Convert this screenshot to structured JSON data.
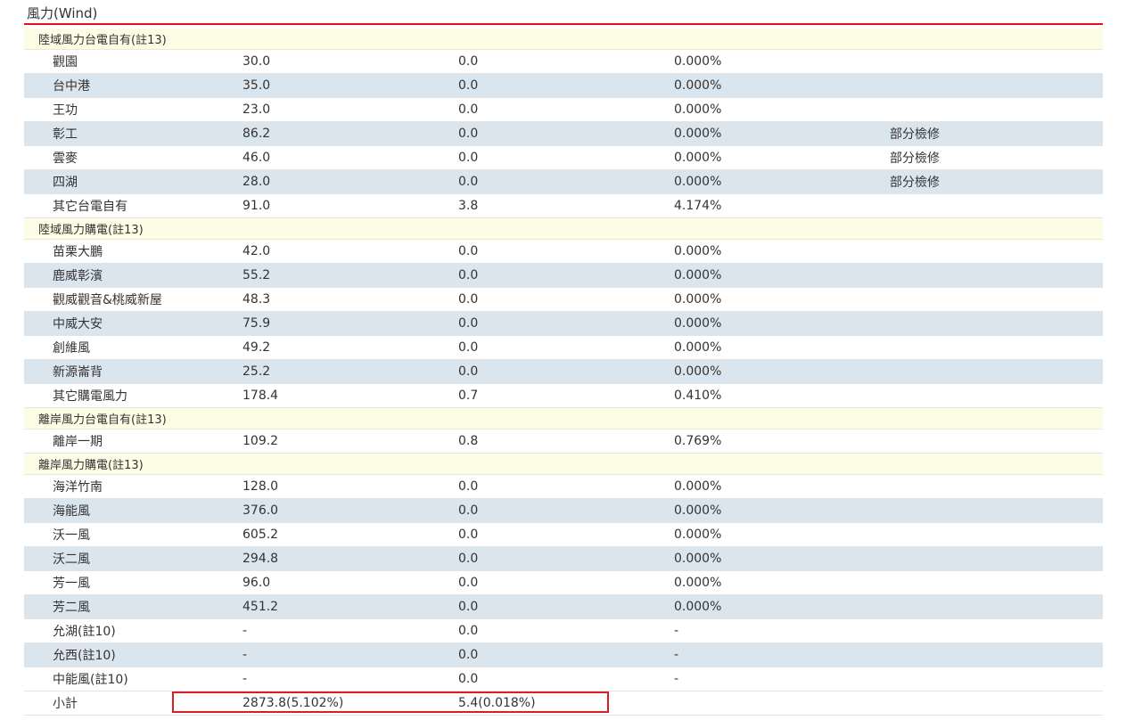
{
  "section": {
    "title": "風力(Wind)"
  },
  "colors": {
    "accent_red": "#e5101a",
    "row_alt": "#dbe5ee",
    "group_bg": "#fdfce4"
  },
  "groups": [
    {
      "label": "陸域風力台電自有(註13)",
      "rows": [
        {
          "name": "觀園",
          "capacity": "30.0",
          "generation": "0.0",
          "ratio": "0.000%",
          "note": ""
        },
        {
          "name": "台中港",
          "capacity": "35.0",
          "generation": "0.0",
          "ratio": "0.000%",
          "note": ""
        },
        {
          "name": "王功",
          "capacity": "23.0",
          "generation": "0.0",
          "ratio": "0.000%",
          "note": ""
        },
        {
          "name": "彰工",
          "capacity": "86.2",
          "generation": "0.0",
          "ratio": "0.000%",
          "note": "部分檢修"
        },
        {
          "name": "雲麥",
          "capacity": "46.0",
          "generation": "0.0",
          "ratio": "0.000%",
          "note": "部分檢修"
        },
        {
          "name": "四湖",
          "capacity": "28.0",
          "generation": "0.0",
          "ratio": "0.000%",
          "note": "部分檢修"
        },
        {
          "name": "其它台電自有",
          "capacity": "91.0",
          "generation": "3.8",
          "ratio": "4.174%",
          "note": ""
        }
      ]
    },
    {
      "label": "陸域風力購電(註13)",
      "rows": [
        {
          "name": "苗栗大鵬",
          "capacity": "42.0",
          "generation": "0.0",
          "ratio": "0.000%",
          "note": ""
        },
        {
          "name": "鹿威彰濱",
          "capacity": "55.2",
          "generation": "0.0",
          "ratio": "0.000%",
          "note": ""
        },
        {
          "name": "觀威觀音&桃威新屋",
          "capacity": "48.3",
          "generation": "0.0",
          "ratio": "0.000%",
          "note": ""
        },
        {
          "name": "中威大安",
          "capacity": "75.9",
          "generation": "0.0",
          "ratio": "0.000%",
          "note": ""
        },
        {
          "name": "創維風",
          "capacity": "49.2",
          "generation": "0.0",
          "ratio": "0.000%",
          "note": ""
        },
        {
          "name": "新源崙背",
          "capacity": "25.2",
          "generation": "0.0",
          "ratio": "0.000%",
          "note": ""
        },
        {
          "name": "其它購電風力",
          "capacity": "178.4",
          "generation": "0.7",
          "ratio": "0.410%",
          "note": ""
        }
      ]
    },
    {
      "label": "離岸風力台電自有(註13)",
      "rows": [
        {
          "name": "離岸一期",
          "capacity": "109.2",
          "generation": "0.8",
          "ratio": "0.769%",
          "note": ""
        }
      ]
    },
    {
      "label": "離岸風力購電(註13)",
      "rows": [
        {
          "name": "海洋竹南",
          "capacity": "128.0",
          "generation": "0.0",
          "ratio": "0.000%",
          "note": ""
        },
        {
          "name": "海能風",
          "capacity": "376.0",
          "generation": "0.0",
          "ratio": "0.000%",
          "note": ""
        },
        {
          "name": "沃一風",
          "capacity": "605.2",
          "generation": "0.0",
          "ratio": "0.000%",
          "note": ""
        },
        {
          "name": "沃二風",
          "capacity": "294.8",
          "generation": "0.0",
          "ratio": "0.000%",
          "note": ""
        },
        {
          "name": "芳一風",
          "capacity": "96.0",
          "generation": "0.0",
          "ratio": "0.000%",
          "note": ""
        },
        {
          "name": "芳二風",
          "capacity": "451.2",
          "generation": "0.0",
          "ratio": "0.000%",
          "note": ""
        },
        {
          "name": "允湖(註10)",
          "capacity": "-",
          "generation": "0.0",
          "ratio": "-",
          "note": ""
        },
        {
          "name": "允西(註10)",
          "capacity": "-",
          "generation": "0.0",
          "ratio": "-",
          "note": ""
        },
        {
          "name": "中能風(註10)",
          "capacity": "-",
          "generation": "0.0",
          "ratio": "-",
          "note": ""
        }
      ]
    }
  ],
  "subtotal": {
    "label": "小計",
    "capacity": "2873.8(5.102%)",
    "generation": "5.4(0.018%)"
  }
}
